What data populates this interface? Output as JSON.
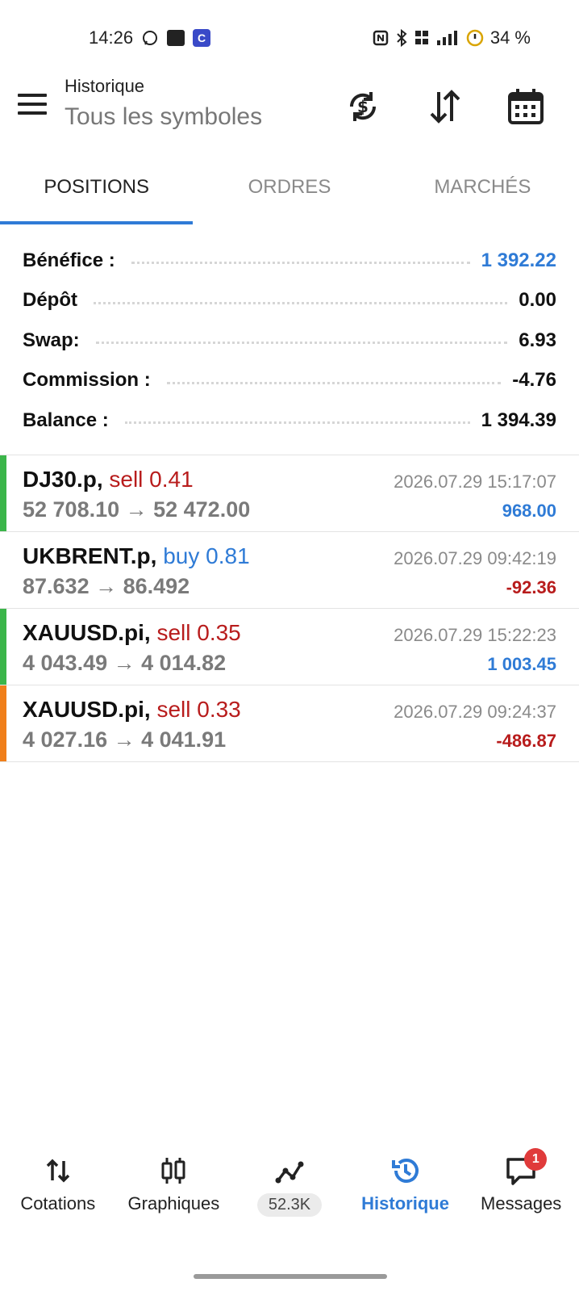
{
  "status_bar": {
    "time": "14:26",
    "battery": "34 %",
    "notif_letter": "C"
  },
  "header": {
    "title": "Historique",
    "subtitle": "Tous les symboles"
  },
  "tabs": [
    {
      "label": "POSITIONS",
      "active": true
    },
    {
      "label": "ORDRES",
      "active": false
    },
    {
      "label": "MARCHÉS",
      "active": false
    }
  ],
  "summary": [
    {
      "label": "Bénéfice :",
      "value": "1 392.22"
    },
    {
      "label": "Dépôt",
      "value": "0.00"
    },
    {
      "label": "Swap:",
      "value": "6.93"
    },
    {
      "label": "Commission :",
      "value": "-4.76"
    },
    {
      "label": "Balance :",
      "value": "1 394.39"
    }
  ],
  "trades": [
    {
      "symbol": "DJ30.p,",
      "side": "sell 0.41",
      "prices": "52 708.10 → 52 472.00",
      "time": "2026.07.29 15:17:07",
      "profit": "968.00",
      "bar_color": "#3bb54a"
    },
    {
      "symbol": "UKBRENT.p,",
      "side": "buy 0.81",
      "prices": "87.632 → 86.492",
      "time": "2026.07.29 09:42:19",
      "profit": "-92.36",
      "bar_color": ""
    },
    {
      "symbol": "XAUUSD.pi,",
      "side": "sell 0.35",
      "prices": "4 043.49 → 4 014.82",
      "time": "2026.07.29 15:22:23",
      "profit": "1 003.45",
      "bar_color": "#3bb54a"
    },
    {
      "symbol": "XAUUSD.pi,",
      "side": "sell 0.33",
      "prices": "4 027.16 → 4 041.91",
      "time": "2026.07.29 09:24:37",
      "profit": "-486.87",
      "bar_color": "#f07f1a"
    }
  ],
  "bottom_nav": [
    {
      "label": "Cotations",
      "icon": "arrows-updown-icon"
    },
    {
      "label": "Graphiques",
      "icon": "candlestick-icon"
    },
    {
      "label": "52.3K",
      "icon": "trend-icon"
    },
    {
      "label": "Historique",
      "icon": "history-icon",
      "active": true
    },
    {
      "label": "Messages",
      "icon": "messages-icon",
      "badge": "1"
    }
  ],
  "colors": {
    "accent": "#2f7bd6",
    "loss": "#b81c1c",
    "win_bar": "#3bb54a",
    "orange_bar": "#f07f1a"
  }
}
